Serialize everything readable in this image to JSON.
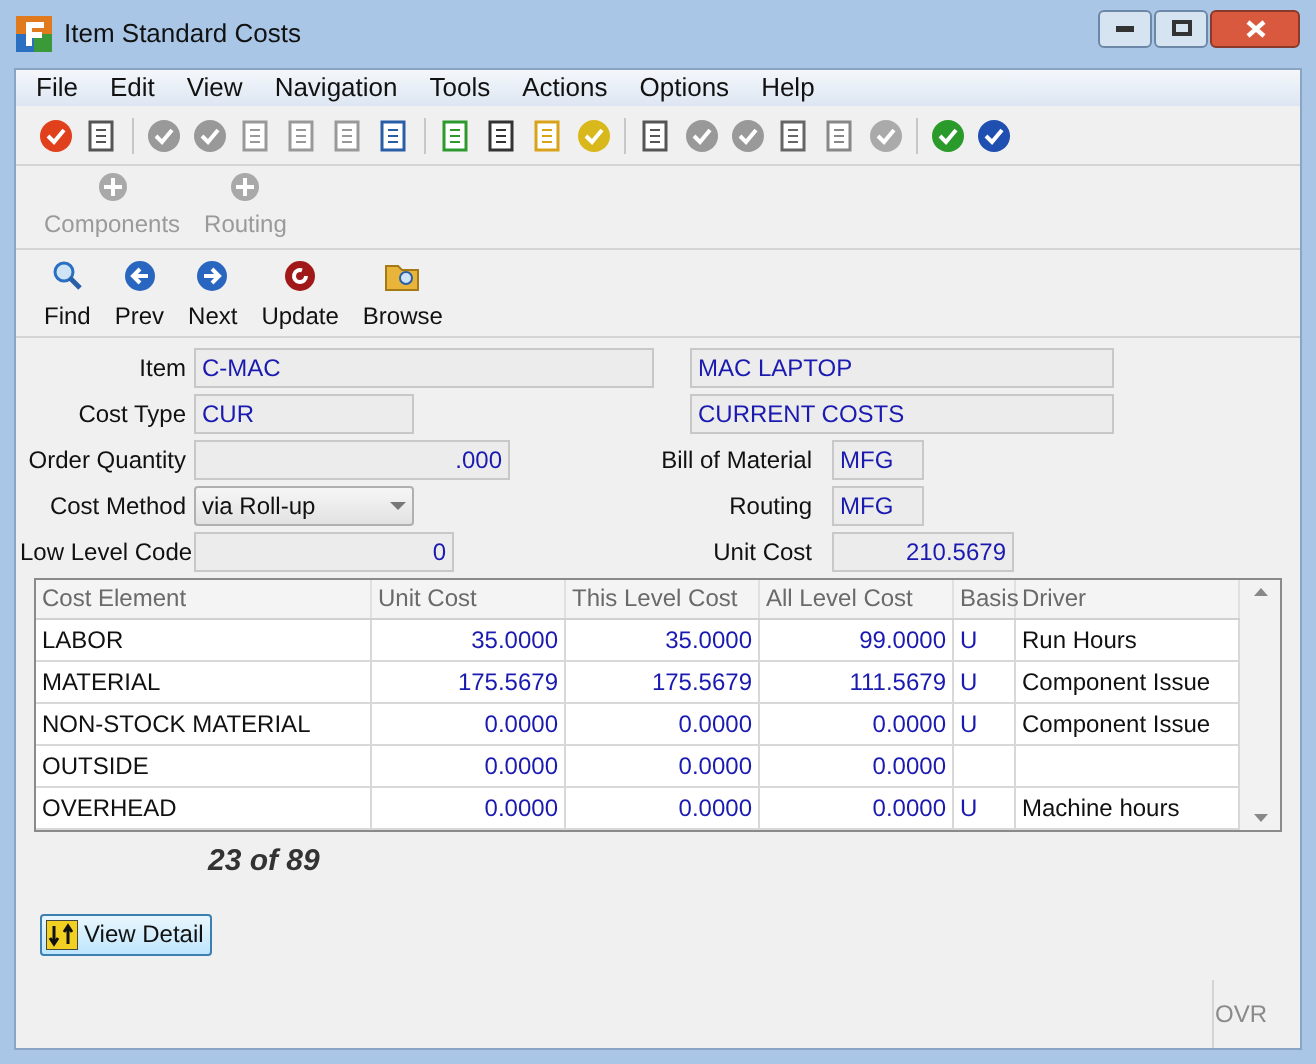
{
  "window": {
    "title": "Item Standard Costs"
  },
  "menu": [
    "File",
    "Edit",
    "View",
    "Navigation",
    "Tools",
    "Actions",
    "Options",
    "Help"
  ],
  "action_toolbar": [
    {
      "label": "Components",
      "disabled": true
    },
    {
      "label": "Routing",
      "disabled": true
    }
  ],
  "nav_toolbar": [
    {
      "label": "Find",
      "kind": "find"
    },
    {
      "label": "Prev",
      "kind": "prev"
    },
    {
      "label": "Next",
      "kind": "next"
    },
    {
      "label": "Update",
      "kind": "update"
    },
    {
      "label": "Browse",
      "kind": "browse"
    }
  ],
  "form": {
    "item": {
      "label": "Item",
      "value": "C-MAC",
      "description": "MAC LAPTOP"
    },
    "cost_type": {
      "label": "Cost Type",
      "value": "CUR",
      "description": "CURRENT COSTS"
    },
    "order_quantity": {
      "label": "Order Quantity",
      "value": ".000"
    },
    "cost_method": {
      "label": "Cost Method",
      "value": "via Roll-up"
    },
    "low_level_code": {
      "label": "Low Level Code",
      "value": "0"
    },
    "bill_of_material": {
      "label": "Bill of Material",
      "value": "MFG"
    },
    "routing": {
      "label": "Routing",
      "value": "MFG"
    },
    "unit_cost": {
      "label": "Unit Cost",
      "value": "210.5679"
    }
  },
  "table": {
    "columns": [
      "Cost Element",
      "Unit Cost",
      "This Level Cost",
      "All Level Cost",
      "Basis",
      "Driver"
    ],
    "rows": [
      [
        "LABOR",
        "35.0000",
        "35.0000",
        "99.0000",
        "U",
        "Run Hours"
      ],
      [
        "MATERIAL",
        "175.5679",
        "175.5679",
        "111.5679",
        "U",
        "Component Issue"
      ],
      [
        "NON-STOCK MATERIAL",
        "0.0000",
        "0.0000",
        "0.0000",
        "U",
        "Component Issue"
      ],
      [
        "OUTSIDE",
        "0.0000",
        "0.0000",
        "0.0000",
        "",
        ""
      ],
      [
        "OVERHEAD",
        "0.0000",
        "0.0000",
        "0.0000",
        "U",
        "Machine hours"
      ]
    ]
  },
  "record_count": "23 of 89",
  "view_detail_button": "View Detail",
  "status_bar": {
    "mode": "OVR"
  }
}
